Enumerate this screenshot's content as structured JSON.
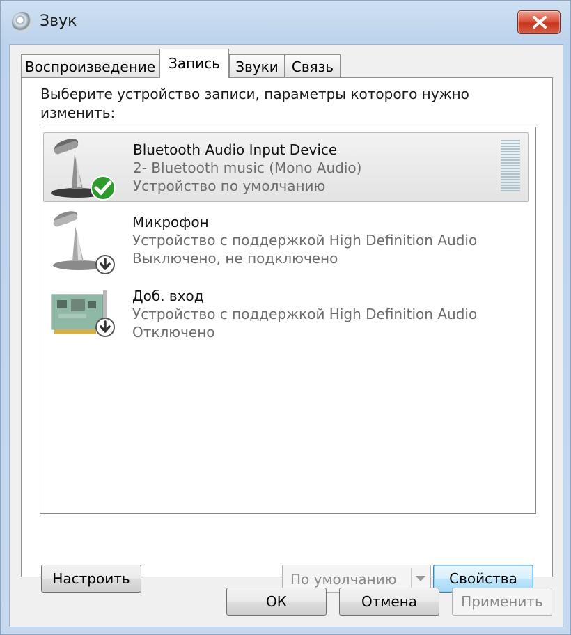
{
  "window": {
    "title": "Звук"
  },
  "tabs": [
    {
      "label": "Воспроизведение"
    },
    {
      "label": "Запись"
    },
    {
      "label": "Звуки"
    },
    {
      "label": "Связь"
    }
  ],
  "instruction": "Выберите устройство записи, параметры которого нужно изменить:",
  "devices": [
    {
      "name": "Bluetooth Audio Input Device",
      "line1": "2- Bluetooth music (Mono Audio)",
      "line2": "Устройство по умолчанию",
      "icon": "microphone-icon",
      "badge": "check-badge-icon",
      "selected": true
    },
    {
      "name": "Микрофон",
      "line1": "Устройство с поддержкой High Definition Audio",
      "line2": "Выключено, не подключено",
      "icon": "microphone-icon",
      "badge": "down-arrow-badge-icon"
    },
    {
      "name": "Доб. вход",
      "line1": "Устройство с поддержкой High Definition Audio",
      "line2": "Отключено",
      "icon": "sound-card-icon",
      "badge": "down-arrow-badge-icon"
    }
  ],
  "buttons": {
    "configure": "Настроить",
    "set_default": "По умолчанию",
    "properties": "Свойства",
    "ok": "ОК",
    "cancel": "Отмена",
    "apply": "Применить"
  },
  "colors": {
    "accent": "#3c7fb1",
    "close": "#c5321c",
    "check": "#2e9a2e"
  }
}
